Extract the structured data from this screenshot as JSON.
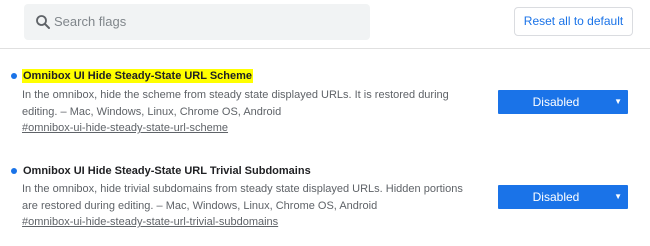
{
  "search": {
    "placeholder": "Search flags",
    "icon": "search-icon"
  },
  "toolbar": {
    "reset_label": "Reset all to default"
  },
  "experiments": [
    {
      "title": "Omnibox UI Hide Steady-State URL Scheme",
      "highlighted": true,
      "description": "In the omnibox, hide the scheme from steady state displayed URLs. It is restored during editing. – Mac, Windows, Linux, Chrome OS, Android",
      "description_lines": [
        "In the omnibox, hide the scheme from steady state displayed URLs. It is restored during",
        "editing. – Mac, Windows, Linux, Chrome OS, Android"
      ],
      "permalink": "#omnibox-ui-hide-steady-state-url-scheme",
      "select_value": "Disabled"
    },
    {
      "title": "Omnibox UI Hide Steady-State URL Trivial Subdomains",
      "highlighted": false,
      "description": "In the omnibox, hide trivial subdomains from steady state displayed URLs. Hidden portions are restored during editing. – Mac, Windows, Linux, Chrome OS, Android",
      "description_lines": [
        "In the omnibox, hide trivial subdomains from steady state displayed URLs. Hidden portions",
        "are restored during editing. – Mac, Windows, Linux, Chrome OS, Android"
      ],
      "permalink": "#omnibox-ui-hide-steady-state-url-trivial-subdomains",
      "select_value": "Disabled"
    }
  ],
  "colors": {
    "accent": "#1a73e8",
    "highlight": "#ffff00",
    "search_bg": "#f1f3f4",
    "text_primary": "#202124",
    "text_secondary": "#5f6368"
  }
}
